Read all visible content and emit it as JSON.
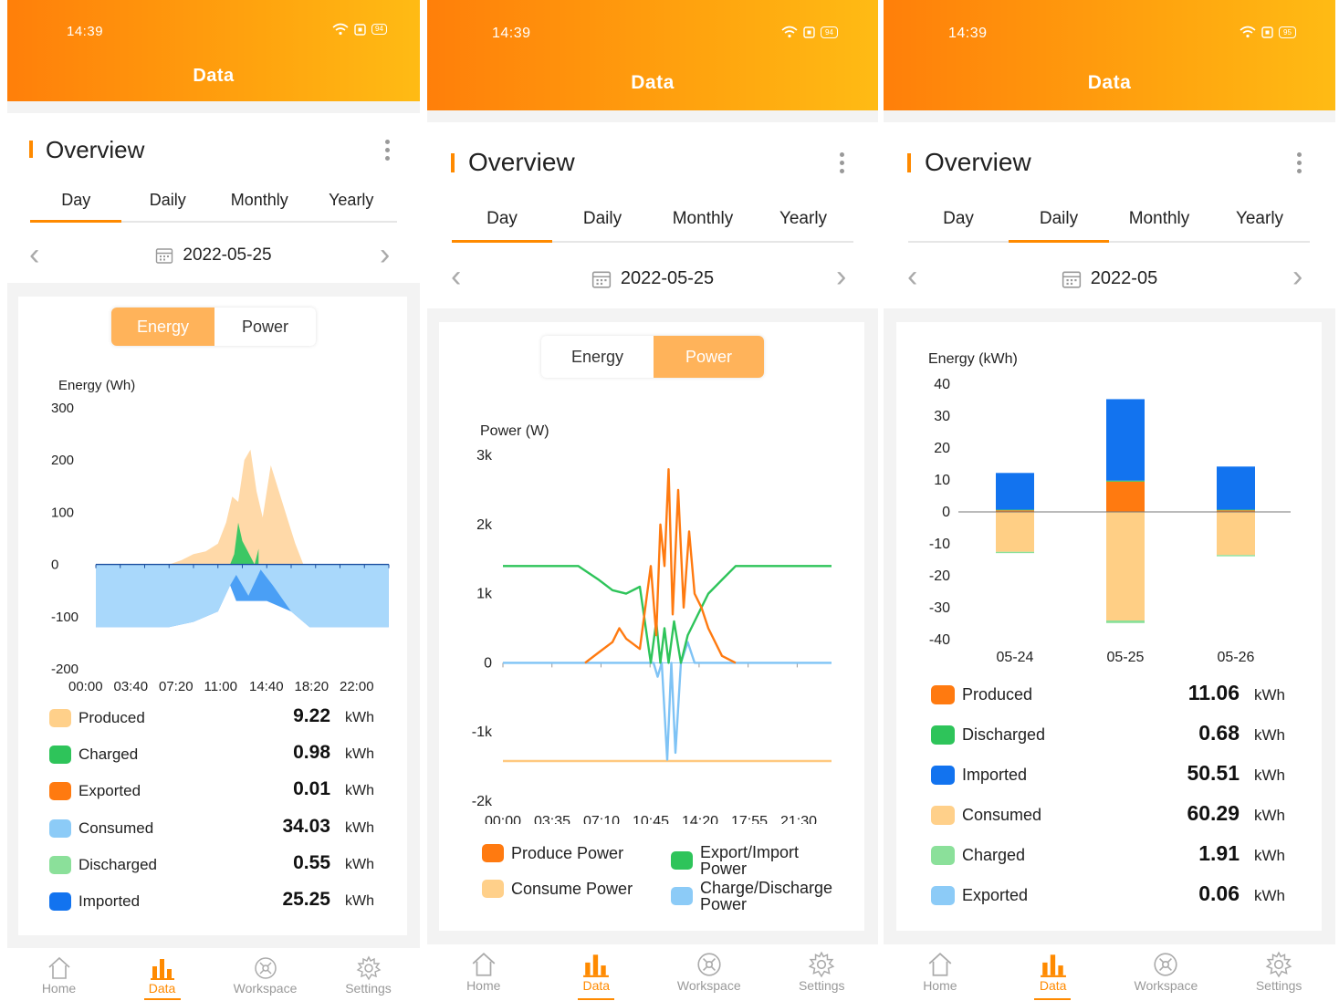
{
  "status_time": "14:39",
  "header_title": "Data",
  "overview_title": "Overview",
  "tabs": [
    "Day",
    "Daily",
    "Monthly",
    "Yearly"
  ],
  "bottom_nav": [
    "Home",
    "Data",
    "Workspace",
    "Settings"
  ],
  "screens": [
    {
      "battery": "94",
      "date": "2022-05-25",
      "selected_tab": "Day",
      "toggle": {
        "energy": "Energy",
        "power": "Power",
        "selected": "Energy"
      },
      "legend": [
        {
          "label": "Produced",
          "value": "9.22",
          "unit": "kWh",
          "color": "#ffd08a"
        },
        {
          "label": "Charged",
          "value": "0.98",
          "unit": "kWh",
          "color": "#2ec45a"
        },
        {
          "label": "Exported",
          "value": "0.01",
          "unit": "kWh",
          "color": "#ff7a10"
        },
        {
          "label": "Consumed",
          "value": "34.03",
          "unit": "kWh",
          "color": "#8ccbf7"
        },
        {
          "label": "Discharged",
          "value": "0.55",
          "unit": "kWh",
          "color": "#8be09a"
        },
        {
          "label": "Imported",
          "value": "25.25",
          "unit": "kWh",
          "color": "#1273ef"
        }
      ]
    },
    {
      "battery": "94",
      "date": "2022-05-25",
      "selected_tab": "Day",
      "toggle": {
        "energy": "Energy",
        "power": "Power",
        "selected": "Power"
      },
      "legend": [
        {
          "label": "Produce Power",
          "color": "#ff7a10"
        },
        {
          "label": "Export/Import Power",
          "color": "#2ec45a"
        },
        {
          "label": "Consume Power",
          "color": "#ffd08a"
        },
        {
          "label": "Charge/Discharge Power",
          "color": "#8ccbf7"
        }
      ]
    },
    {
      "battery": "95",
      "date": "2022-05",
      "selected_tab": "Daily",
      "legend": [
        {
          "label": "Produced",
          "value": "11.06",
          "unit": "kWh",
          "color": "#ff7a10"
        },
        {
          "label": "Discharged",
          "value": "0.68",
          "unit": "kWh",
          "color": "#2ec45a"
        },
        {
          "label": "Imported",
          "value": "50.51",
          "unit": "kWh",
          "color": "#1273ef"
        },
        {
          "label": "Consumed",
          "value": "60.29",
          "unit": "kWh",
          "color": "#ffd08a"
        },
        {
          "label": "Charged",
          "value": "1.91",
          "unit": "kWh",
          "color": "#8be09a"
        },
        {
          "label": "Exported",
          "value": "0.06",
          "unit": "kWh",
          "color": "#8ccbf7"
        }
      ]
    }
  ],
  "chart_data": [
    {
      "type": "area",
      "ylabel": "Energy (Wh)",
      "y_ticks": [
        "300",
        "200",
        "100",
        "0",
        "-100",
        "-200"
      ],
      "ylim": [
        -200,
        300
      ],
      "x_ticks": [
        "00:00",
        "03:40",
        "07:20",
        "11:00",
        "14:40",
        "18:20",
        "22:00"
      ],
      "series": [
        {
          "name": "Produced",
          "x": [
            "06:00",
            "07:00",
            "08:00",
            "09:00",
            "10:00",
            "10:40",
            "11:10",
            "11:40",
            "12:10",
            "12:40",
            "13:10",
            "13:40",
            "14:20",
            "15:00",
            "15:40",
            "16:20",
            "17:00"
          ],
          "values": [
            0,
            8,
            20,
            25,
            40,
            80,
            130,
            120,
            200,
            220,
            140,
            90,
            190,
            140,
            90,
            40,
            0
          ]
        },
        {
          "name": "Charged",
          "x": [
            "11:00",
            "11:20",
            "11:40",
            "12:00",
            "12:20",
            "13:00",
            "13:20"
          ],
          "values": [
            0,
            20,
            80,
            45,
            30,
            0,
            30
          ]
        },
        {
          "name": "Imported",
          "x": [
            "00:00",
            "06:00",
            "08:00",
            "10:00",
            "11:00",
            "11:30",
            "14:00",
            "16:00",
            "17:30",
            "23:59"
          ],
          "values": [
            -120,
            -120,
            -110,
            -90,
            -40,
            -70,
            -70,
            -90,
            -120,
            -120
          ]
        },
        {
          "name": "Consumed",
          "x": [
            "00:00",
            "06:00",
            "08:00",
            "10:00",
            "11:00",
            "11:30",
            "12:30",
            "13:30",
            "14:30",
            "16:00",
            "17:30",
            "23:59"
          ],
          "values": [
            -120,
            -120,
            -110,
            -90,
            -40,
            -20,
            -60,
            -10,
            -40,
            -90,
            -120,
            -120
          ]
        }
      ]
    },
    {
      "type": "line",
      "ylabel": "Power (W)",
      "y_ticks": [
        "3k",
        "2k",
        "1k",
        "0",
        "-1k",
        "-2k"
      ],
      "ylim": [
        -2000,
        3000
      ],
      "x_ticks": [
        "00:00",
        "03:35",
        "07:10",
        "10:45",
        "14:20",
        "17:55",
        "21:30"
      ],
      "series": [
        {
          "name": "Produce Power",
          "x": [
            6.0,
            7.0,
            8.0,
            8.5,
            9.0,
            10.0,
            10.8,
            11.2,
            11.5,
            11.8,
            12.1,
            12.4,
            12.8,
            13.2,
            13.6,
            14.0,
            14.5,
            15.0,
            16.0,
            17.0
          ],
          "values": [
            0,
            150,
            300,
            500,
            350,
            200,
            1400,
            400,
            2000,
            1400,
            2800,
            700,
            2500,
            800,
            1900,
            1000,
            800,
            500,
            100,
            0
          ]
        },
        {
          "name": "Export/Import Power",
          "x": [
            0,
            5.5,
            7.0,
            8.0,
            9.0,
            10.0,
            10.8,
            11.2,
            11.5,
            11.8,
            12.1,
            12.5,
            13.0,
            13.5,
            14.0,
            15.0,
            16.0,
            17.0,
            24.0
          ],
          "values": [
            1400,
            1400,
            1200,
            1050,
            1000,
            1100,
            0,
            600,
            0,
            500,
            0,
            600,
            0,
            400,
            600,
            1000,
            1200,
            1400,
            1400
          ]
        },
        {
          "name": "Consume Power",
          "x": [
            0,
            24.0
          ],
          "values": [
            -1420,
            -1420
          ]
        },
        {
          "name": "Charge/Discharge Power",
          "x": [
            0,
            11.0,
            11.3,
            11.6,
            12.0,
            12.3,
            12.6,
            13.0,
            13.5,
            14.0,
            15.0,
            24.0
          ],
          "values": [
            0,
            0,
            -200,
            0,
            -1400,
            0,
            -1300,
            0,
            300,
            0,
            0,
            0
          ]
        }
      ]
    },
    {
      "type": "bar",
      "ylabel": "Energy (kWh)",
      "y_ticks": [
        "40",
        "30",
        "20",
        "10",
        "0",
        "-10",
        "-20",
        "-30",
        "-40"
      ],
      "ylim": [
        -40,
        40
      ],
      "categories": [
        "05-24",
        "05-25",
        "05-26"
      ],
      "series": [
        {
          "name": "Produced",
          "values": [
            0.5,
            9.5,
            0.5
          ]
        },
        {
          "name": "Discharged",
          "values": [
            0.2,
            0.3,
            0.2
          ]
        },
        {
          "name": "Imported",
          "values": [
            11.5,
            25.5,
            13.5
          ]
        },
        {
          "name": "Consumed",
          "values": [
            -12.5,
            -34,
            -13.5
          ]
        },
        {
          "name": "Charged",
          "values": [
            -0.4,
            -0.8,
            -0.4
          ]
        },
        {
          "name": "Exported",
          "values": [
            0,
            0,
            0
          ]
        }
      ]
    }
  ]
}
